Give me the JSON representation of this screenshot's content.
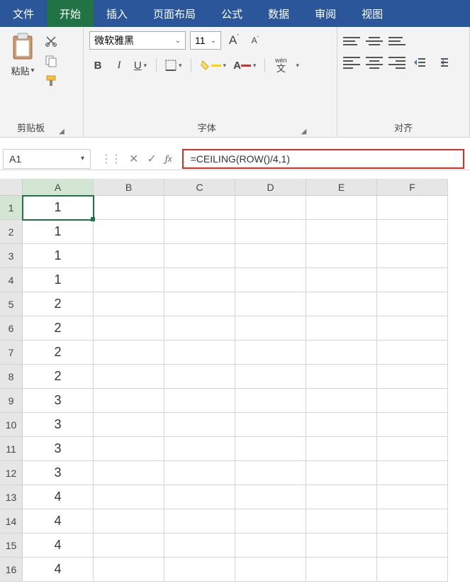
{
  "tabs": {
    "file": "文件",
    "home": "开始",
    "insert": "插入",
    "layout": "页面布局",
    "formulas": "公式",
    "data": "数据",
    "review": "审阅",
    "view": "视图"
  },
  "ribbon": {
    "clipboard": {
      "label": "剪贴板",
      "paste": "粘贴"
    },
    "font": {
      "label": "字体",
      "name": "微软雅黑",
      "size": "11",
      "bold": "B",
      "italic": "I",
      "underline": "U",
      "wen": "wén",
      "wen2": "文"
    },
    "alignment": {
      "label": "对齐"
    }
  },
  "namebox": "A1",
  "formula": "=CEILING(ROW()/4,1)",
  "columns": [
    "A",
    "B",
    "C",
    "D",
    "E",
    "F"
  ],
  "rows": [
    "1",
    "2",
    "3",
    "4",
    "5",
    "6",
    "7",
    "8",
    "9",
    "10",
    "11",
    "12",
    "13",
    "14",
    "15",
    "16"
  ],
  "cells": {
    "A": [
      "1",
      "1",
      "1",
      "1",
      "2",
      "2",
      "2",
      "2",
      "3",
      "3",
      "3",
      "3",
      "4",
      "4",
      "4",
      "4"
    ]
  },
  "active_cell": {
    "col": "A",
    "row": "1"
  }
}
